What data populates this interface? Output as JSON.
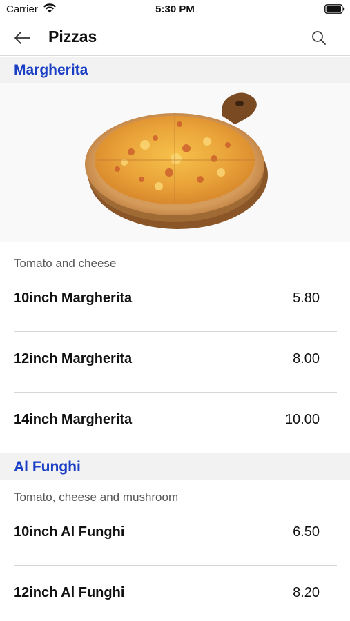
{
  "status_bar": {
    "carrier": "Carrier",
    "time": "5:30 PM"
  },
  "nav": {
    "title": "Pizzas",
    "back_icon": "arrow-left-icon",
    "search_icon": "search-icon"
  },
  "colors": {
    "section_title": "#1a3fc4",
    "section_bg": "#f2f2f2",
    "divider": "#d6d6d6"
  },
  "sections": [
    {
      "title": "Margherita",
      "image": "margherita-pizza-on-board",
      "description": "Tomato and cheese",
      "items": [
        {
          "name": "10inch Margherita",
          "price": "5.80"
        },
        {
          "name": "12inch Margherita",
          "price": "8.00"
        },
        {
          "name": "14inch Margherita",
          "price": "10.00"
        }
      ]
    },
    {
      "title": "Al Funghi",
      "description": "Tomato, cheese and mushroom",
      "items": [
        {
          "name": "10inch Al Funghi",
          "price": "6.50"
        },
        {
          "name": "12inch Al Funghi",
          "price": "8.20"
        }
      ]
    }
  ]
}
